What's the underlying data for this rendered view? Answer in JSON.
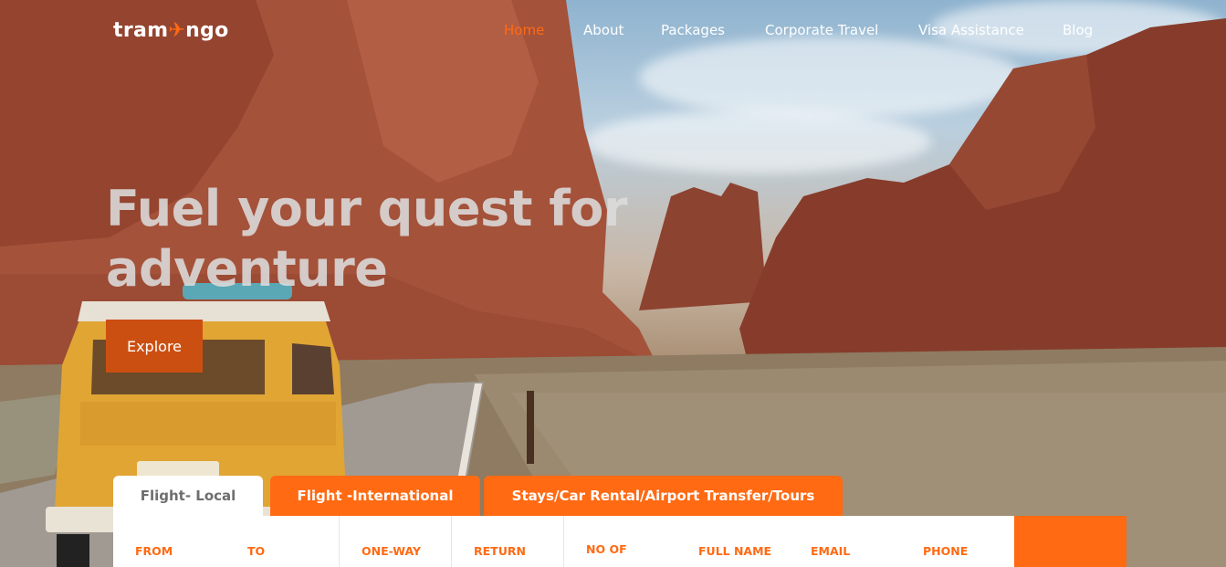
{
  "brand": {
    "name_part1": "tram",
    "name_part2": "ngo"
  },
  "nav": {
    "items": [
      {
        "label": "Home",
        "active": true
      },
      {
        "label": "About",
        "active": false
      },
      {
        "label": "Packages",
        "active": false
      },
      {
        "label": "Corporate Travel",
        "active": false
      },
      {
        "label": "Visa Assistance",
        "active": false
      },
      {
        "label": "Blog",
        "active": false
      }
    ]
  },
  "hero": {
    "headline_line1": "Fuel your quest for",
    "headline_line2": "adventure",
    "cta_label": "Explore"
  },
  "booking": {
    "tabs": [
      {
        "label": "Flight- Local",
        "active": true
      },
      {
        "label": "Flight -International",
        "active": false
      },
      {
        "label": "Stays/Car Rental/Airport Transfer/Tours",
        "active": false
      }
    ],
    "fields": [
      {
        "label": "FROM"
      },
      {
        "label": "TO"
      },
      {
        "label": "ONE-WAY"
      },
      {
        "label": "RETURN"
      },
      {
        "label": "NO OF"
      },
      {
        "label": "FULL NAME"
      },
      {
        "label": "EMAIL"
      },
      {
        "label": "PHONE"
      }
    ]
  },
  "colors": {
    "accent": "#ff6a13",
    "cta": "#cc4f12",
    "headline": "#dcdcdc"
  }
}
